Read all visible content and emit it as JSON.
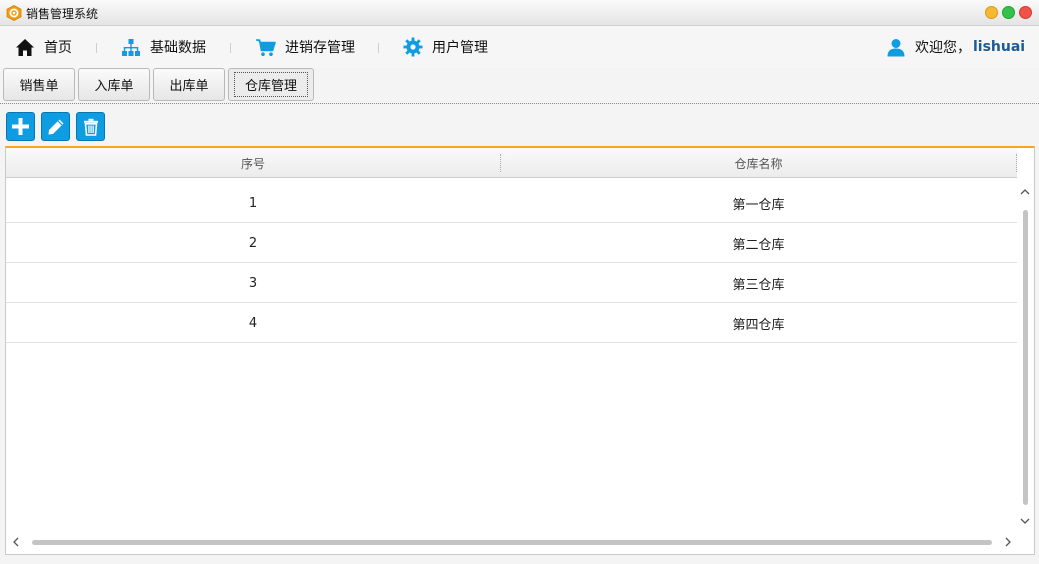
{
  "window": {
    "title": "销售管理系统",
    "app_icon": "hexagon-gear-icon"
  },
  "nav": {
    "items": [
      {
        "label": "首页",
        "icon": "home-icon"
      },
      {
        "label": "基础数据",
        "icon": "sitemap-icon"
      },
      {
        "label": "进销存管理",
        "icon": "cart-icon"
      },
      {
        "label": "用户管理",
        "icon": "gear-icon"
      }
    ],
    "active_index": 2,
    "welcome": "欢迎您，",
    "username": "lishuai"
  },
  "tabs": [
    {
      "label": "销售单"
    },
    {
      "label": "入库单"
    },
    {
      "label": "出库单"
    },
    {
      "label": "仓库管理"
    }
  ],
  "active_tab_index": 3,
  "toolbar": {
    "buttons": [
      {
        "icon": "plus-icon",
        "action": "add"
      },
      {
        "icon": "pencil-icon",
        "action": "edit"
      },
      {
        "icon": "trash-icon",
        "action": "delete"
      }
    ]
  },
  "table": {
    "columns": [
      "序号",
      "仓库名称"
    ],
    "rows": [
      [
        "1",
        "第一仓库"
      ],
      [
        "2",
        "第二仓库"
      ],
      [
        "3",
        "第三仓库"
      ],
      [
        "4",
        "第四仓库"
      ]
    ]
  },
  "colors": {
    "accent": "#0e9de2",
    "header_accent": "#f5a623",
    "username": "#1d5a95"
  }
}
